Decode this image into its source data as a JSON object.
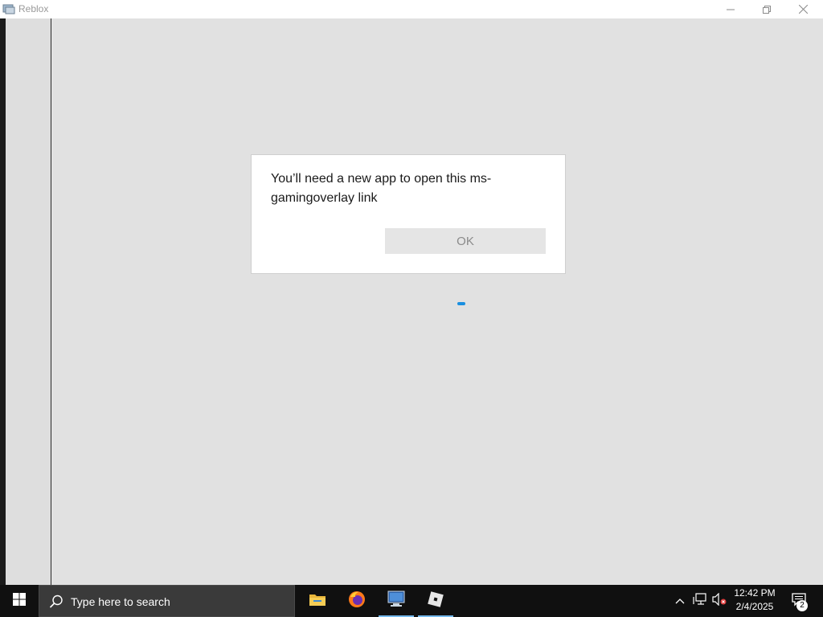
{
  "window": {
    "title": "Reblox",
    "controls": [
      "minimize-icon",
      "restore-icon",
      "close-icon"
    ]
  },
  "dialog": {
    "message": "You’ll need a new app to open this ms-gamingoverlay link",
    "ok_label": "OK"
  },
  "taskbar": {
    "search_placeholder": "Type here to search",
    "apps": [
      "file-explorer-icon",
      "firefox-icon",
      "remote-desktop-icon",
      "roblox-icon"
    ],
    "clock_time": "12:42 PM",
    "clock_date": "2/4/2025",
    "notification_count": "2"
  },
  "colors": {
    "accent": "#1a8fe0",
    "taskbar_bg": "#101010",
    "page_bg": "#e1e1e1"
  }
}
